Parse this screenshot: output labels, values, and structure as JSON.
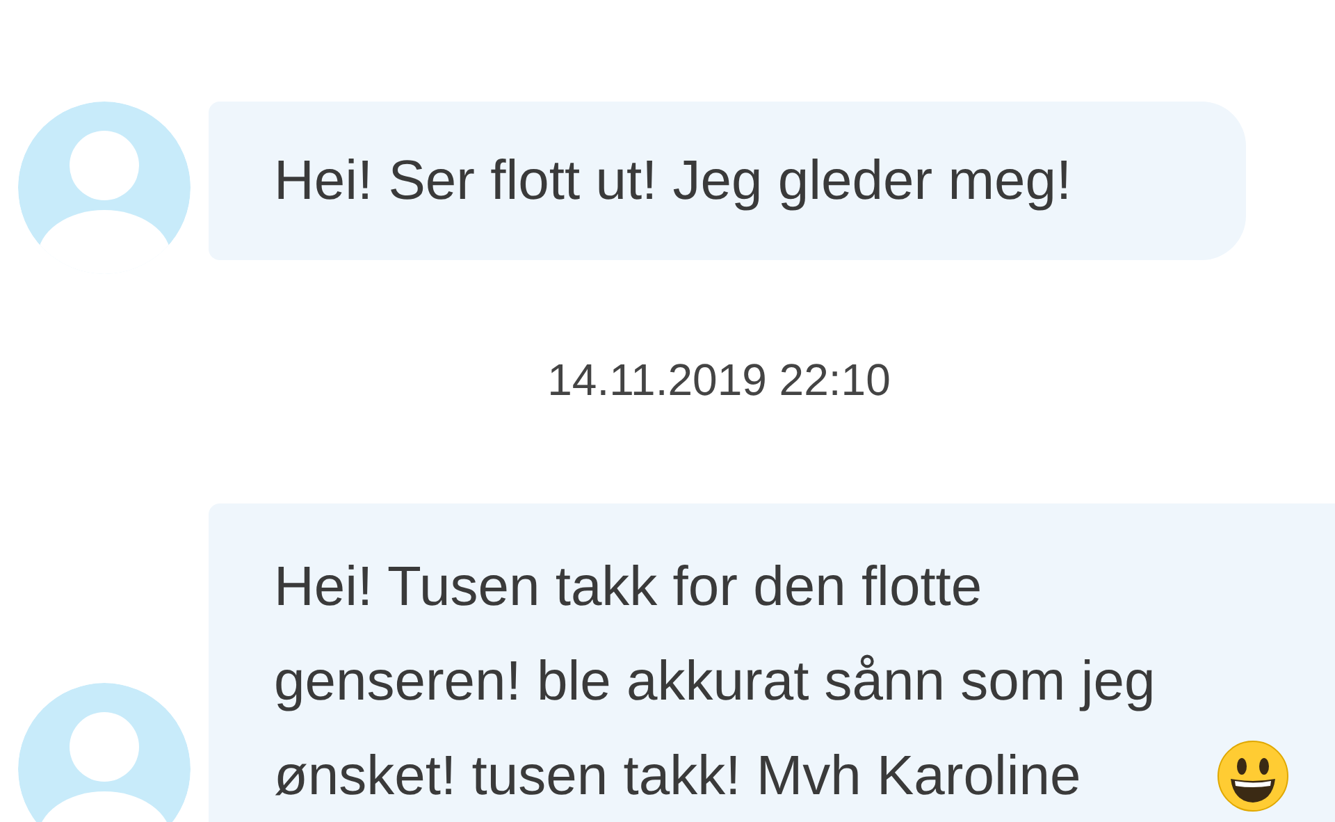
{
  "thread": [
    {
      "kind": "message",
      "text": "Hei! Ser flott ut! Jeg gleder meg!"
    },
    {
      "kind": "timestamp",
      "text": "14.11.2019 22:10"
    },
    {
      "kind": "message",
      "text": "Hei! Tusen takk for den flotte genseren! ble akkurat sånn som jeg ønsket! tusen takk! Mvh Karoline",
      "has_emoji": true
    }
  ]
}
